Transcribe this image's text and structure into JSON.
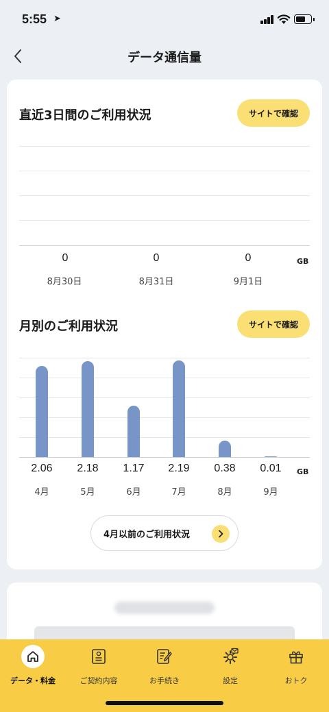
{
  "status": {
    "time": "5:55"
  },
  "header": {
    "title": "データ通信量"
  },
  "recent": {
    "title": "直近3日間のご利用状況",
    "button": "サイトで確認",
    "unit": "GB",
    "days": [
      {
        "label": "8月30日",
        "value": "0"
      },
      {
        "label": "8月31日",
        "value": "0"
      },
      {
        "label": "9月1日",
        "value": "0"
      }
    ]
  },
  "monthly": {
    "title": "月別のご利用状況",
    "button": "サイトで確認",
    "unit": "GB",
    "history_button": "4月以前のご利用状況"
  },
  "chart_data": {
    "type": "bar",
    "categories": [
      "4月",
      "5月",
      "6月",
      "7月",
      "8月",
      "9月"
    ],
    "values": [
      2.06,
      2.18,
      1.17,
      2.19,
      0.38,
      0.01
    ],
    "value_labels": [
      "2.06",
      "2.18",
      "1.17",
      "2.19",
      "0.38",
      "0.01"
    ],
    "ylim": [
      0,
      2.25
    ],
    "color": "#7796c7"
  },
  "tabs": [
    {
      "label": "データ・料金",
      "icon": "home-icon",
      "active": true
    },
    {
      "label": "ご契約内容",
      "icon": "contract-icon",
      "active": false
    },
    {
      "label": "お手続き",
      "icon": "form-edit-icon",
      "active": false
    },
    {
      "label": "設定",
      "icon": "gear-icon",
      "active": false
    },
    {
      "label": "おトク",
      "icon": "gift-icon",
      "active": false
    }
  ],
  "colors": {
    "accent": "#f8cd45",
    "button": "#f9df74",
    "bar": "#7796c7"
  }
}
